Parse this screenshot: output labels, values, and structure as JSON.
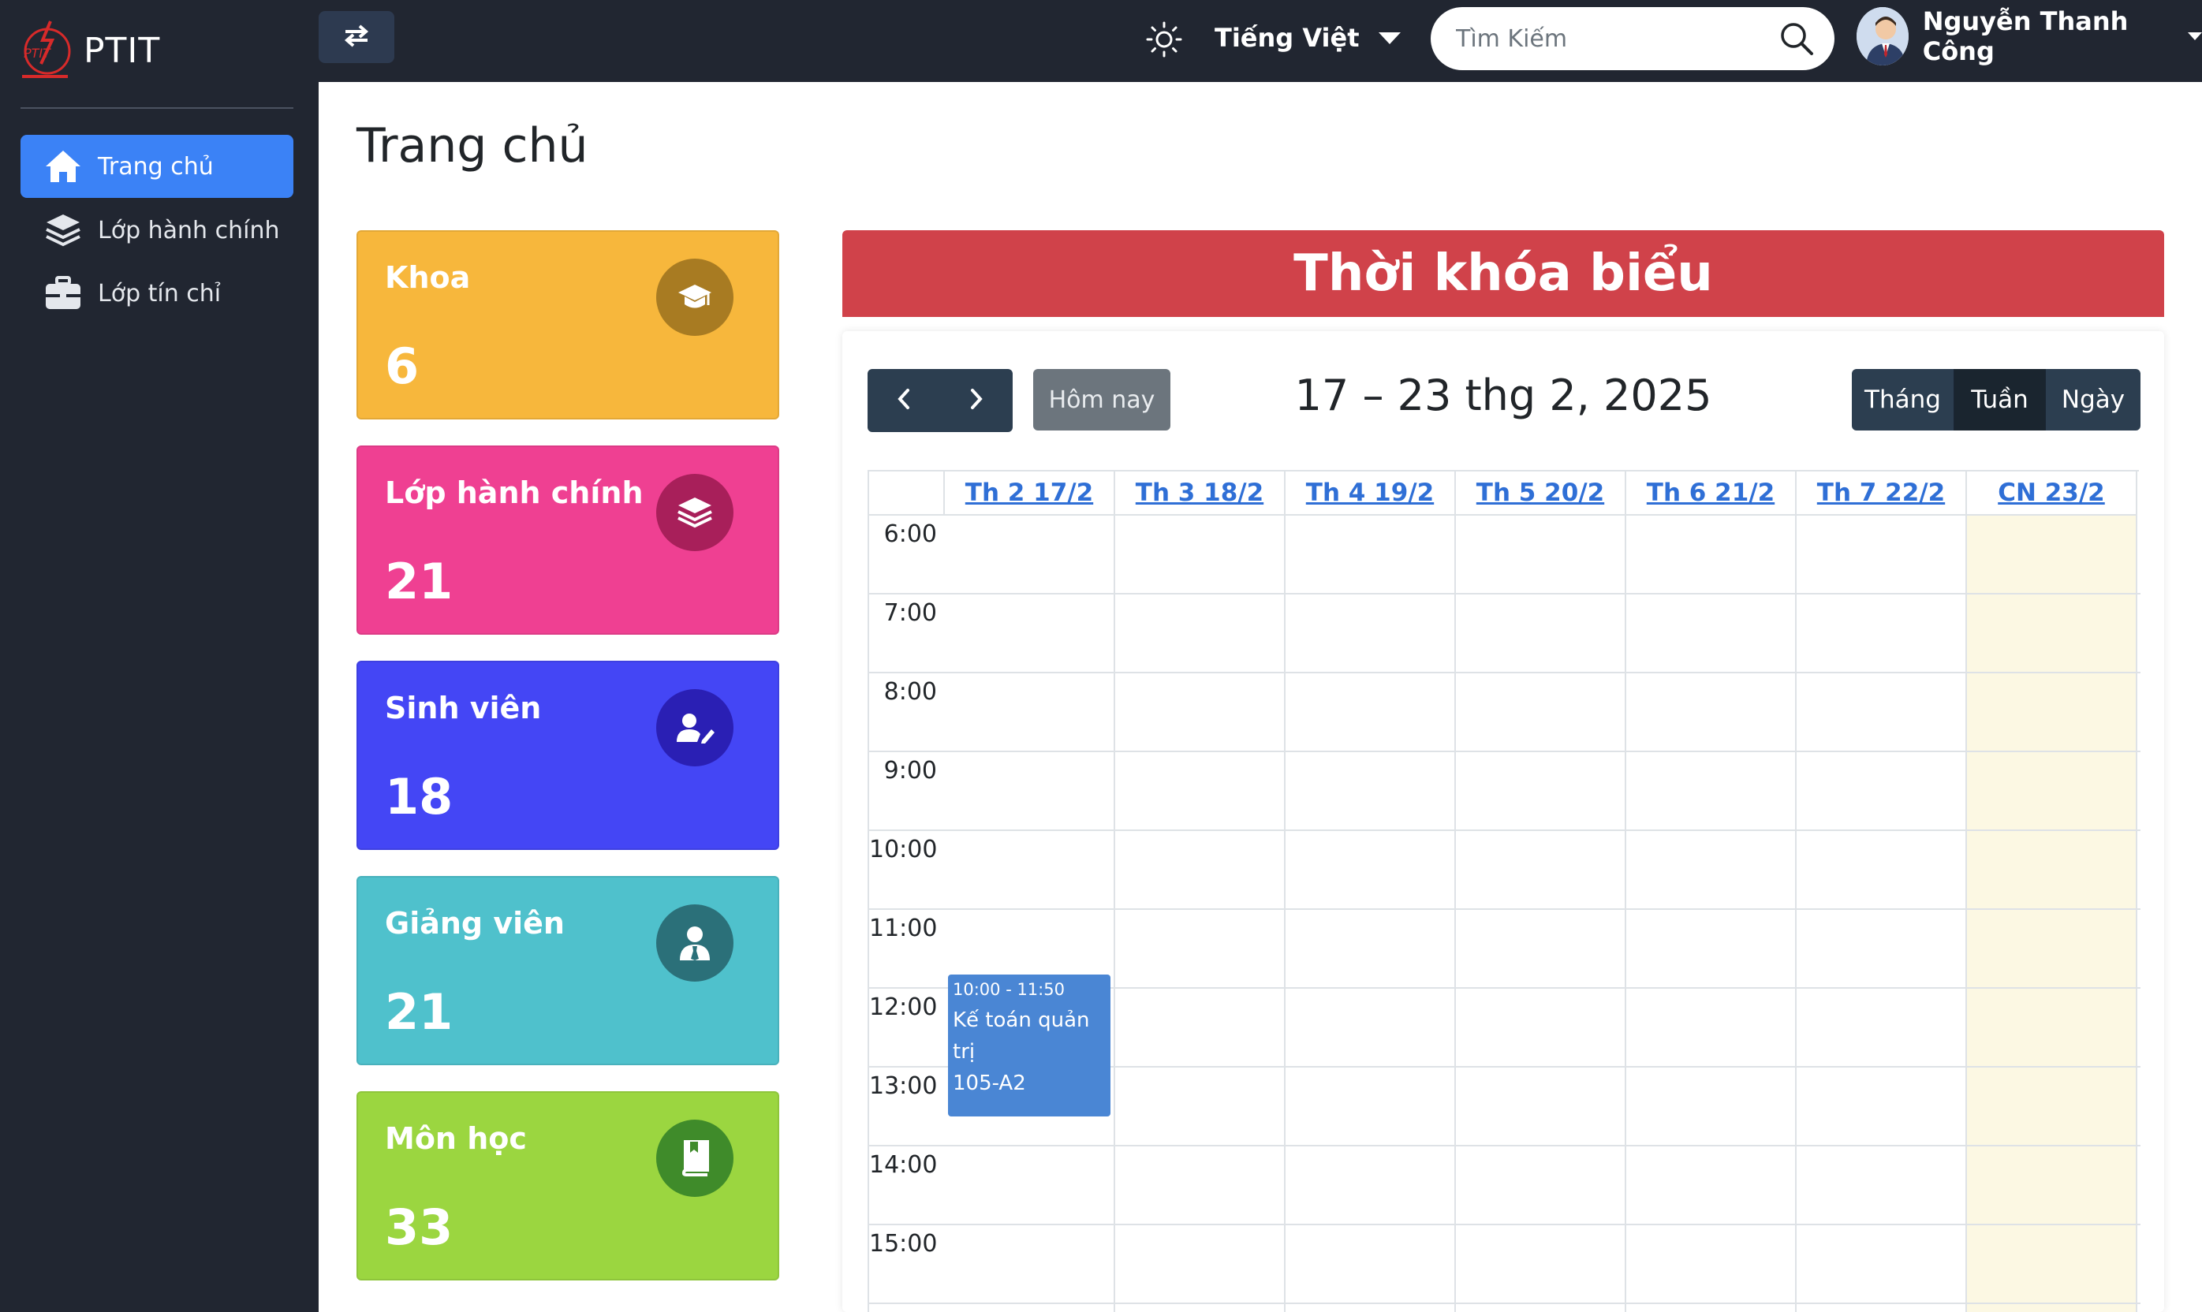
{
  "brand": {
    "name": "PTIT",
    "logo_text": "PTIT"
  },
  "sidebar": {
    "items": [
      {
        "label": "Trang chủ",
        "icon": "home-icon",
        "active": true
      },
      {
        "label": "Lớp hành chính",
        "icon": "layers-icon",
        "active": false
      },
      {
        "label": "Lớp tín chỉ",
        "icon": "briefcase-icon",
        "active": false
      }
    ]
  },
  "topbar": {
    "language": "Tiếng Việt",
    "search_placeholder": "Tìm Kiếm",
    "user_name": "Nguyễn Thanh Công"
  },
  "page": {
    "title": "Trang chủ"
  },
  "stats": [
    {
      "label": "Khoa",
      "value": "6",
      "color": "#f7b73c",
      "icon_bg": "#a87b22",
      "icon": "graduation-cap-icon"
    },
    {
      "label": "Lớp hành chính",
      "value": "21",
      "color": "#ef4092",
      "icon_bg": "#a81f5a",
      "icon": "layers-icon"
    },
    {
      "label": "Sinh viên",
      "value": "18",
      "color": "#4446f5",
      "icon_bg": "#2a1fb4",
      "icon": "user-edit-icon"
    },
    {
      "label": "Giảng viên",
      "value": "21",
      "color": "#4fc1cc",
      "icon_bg": "#2b7079",
      "icon": "user-tie-icon"
    },
    {
      "label": "Môn học",
      "value": "33",
      "color": "#9bd640",
      "icon_bg": "#3f8b2a",
      "icon": "book-icon"
    }
  ],
  "calendar": {
    "title": "Thời khóa biểu",
    "today_label": "Hôm nay",
    "range_label": "17 – 23 thg 2, 2025",
    "views": [
      "Tháng",
      "Tuần",
      "Ngày"
    ],
    "active_view": "Tuần",
    "days": [
      "Th 2 17/2",
      "Th 3 18/2",
      "Th 4 19/2",
      "Th 5 20/2",
      "Th 6 21/2",
      "Th 7 22/2",
      "CN 23/2"
    ],
    "times": [
      "6:00",
      "7:00",
      "8:00",
      "9:00",
      "10:00",
      "11:00",
      "12:00",
      "13:00",
      "14:00",
      "15:00"
    ],
    "events": [
      {
        "time": "10:00 - 11:50",
        "title": "Kế toán quản trị",
        "room": "105-A2",
        "day": "Th 2 17/2",
        "color": "#4a86d4"
      }
    ],
    "header_color": "#d0424a",
    "highlight_color": "#fcf8e3"
  }
}
